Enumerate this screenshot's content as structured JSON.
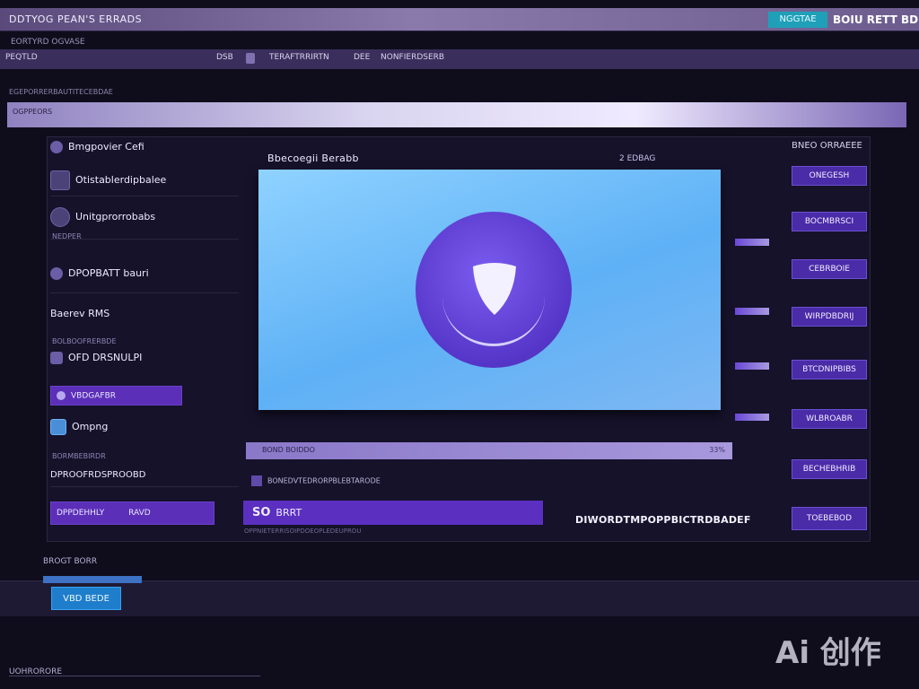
{
  "window": {
    "title": "DDTYOG PEAN'S ERRADS",
    "badge": "NGGTAE",
    "brand": "BOIU RETT BD",
    "subtitle": "EORTYRD OGVASE"
  },
  "menu": {
    "items": [
      "PEQTLD",
      "DSB",
      "TERAFTRRIRTN",
      "DEE",
      "NONFIERDSERB"
    ]
  },
  "path_text": "EGEPORRERBAUTITECEBDAE",
  "strip_label": "OGPPEORS",
  "sidebar": {
    "items": [
      {
        "label": "Bmgpovier Cefi"
      },
      {
        "label": "Otistablerdipbalee"
      },
      {
        "label": "Unitgprorrobabs"
      },
      {
        "label": "DPOPBATT bauri"
      },
      {
        "label": "Baerev RMS"
      },
      {
        "label": "OFD DRSNULPI"
      },
      {
        "label": "VBDGAFBR"
      },
      {
        "label": "Ompng"
      },
      {
        "label": "DPROOFRDSPROOBD"
      }
    ],
    "small_labels": [
      "NEDPER",
      "BOLBOOFRERBDE",
      "BORMBEBIRDR"
    ],
    "bottom_button": {
      "left": "DPPDEHHLY",
      "right": "RAVD"
    }
  },
  "center": {
    "title": "Bbecoegii Berabb",
    "meta": "2 EDBAG",
    "progress_text": "BOND BOIDDO",
    "progress_pct": "33%",
    "file_label": "BONEDVTEDRORPBLEBTARODE",
    "action_prefix": "SO",
    "action_text": "BRRT",
    "status_text": "DIWORDTMPOPPBICTRDBADEF",
    "sub_text": "OPPNIETERRISOIPDOEOPLEDEUPROU"
  },
  "right": {
    "title": "BNEO ORRAEEE",
    "buttons": [
      "ONEGESH",
      "BOCMBRSCI",
      "CEBRBOIE",
      "WIRPDBDRIJ",
      "BTCDNIPBIBS",
      "WLBROABR",
      "BECHEBHRIB",
      "TOEBEBOD"
    ]
  },
  "footer": {
    "label": "BROGT BORR",
    "button": "VBD BEDE",
    "status": "UOHRORORE"
  },
  "watermark": "Ai 创作"
}
